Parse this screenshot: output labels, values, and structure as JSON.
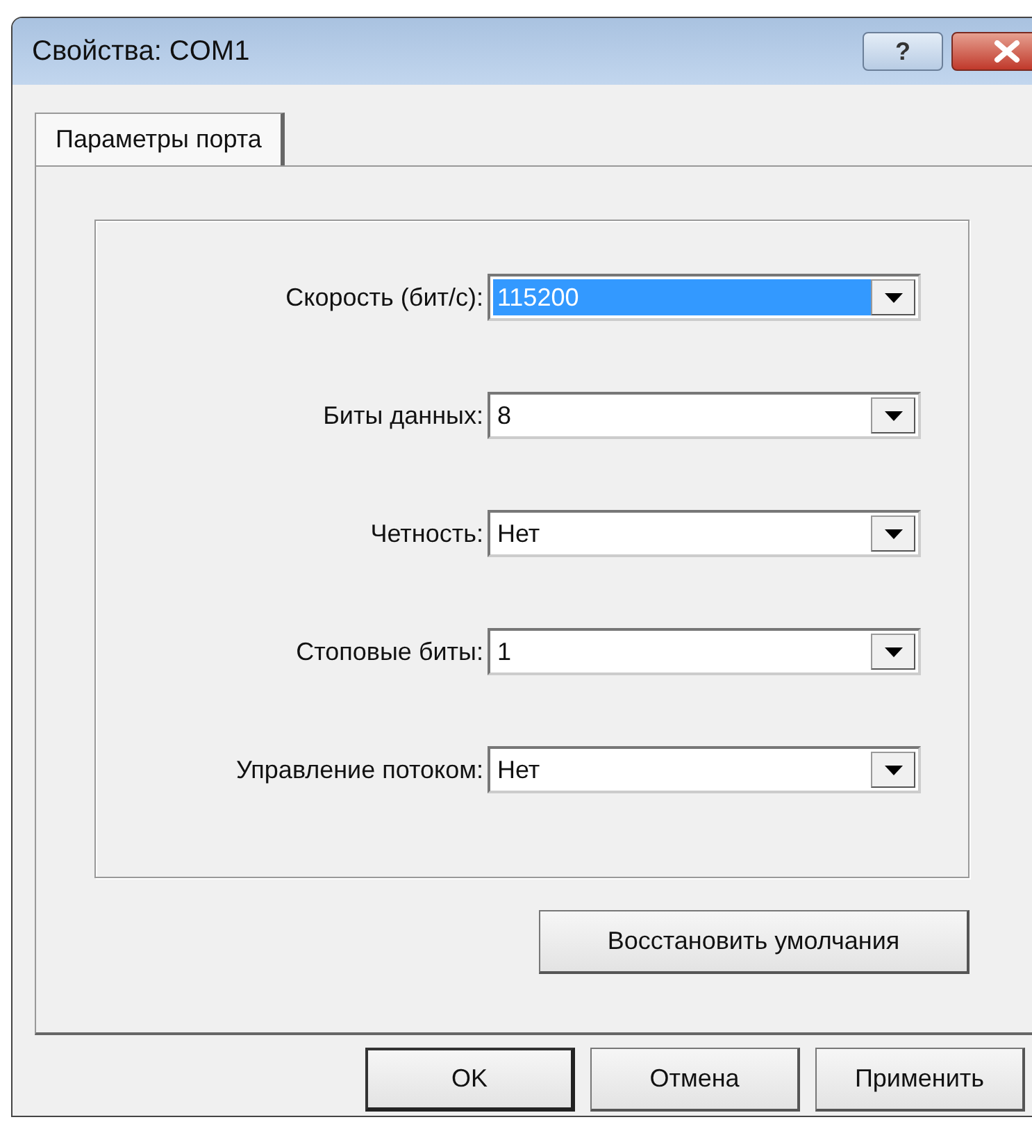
{
  "window": {
    "title": "Свойства: COM1",
    "help_button": "?"
  },
  "tabs": [
    {
      "label": "Параметры порта",
      "selected": true
    }
  ],
  "settings": [
    {
      "label": "Скорость (бит/с):",
      "value": "115200",
      "focused": true
    },
    {
      "label": "Биты данных:",
      "value": "8",
      "focused": false
    },
    {
      "label": "Четность:",
      "value": "Нет",
      "focused": false
    },
    {
      "label": "Стоповые биты:",
      "value": "1",
      "focused": false
    },
    {
      "label": "Управление потоком:",
      "value": "Нет",
      "focused": false
    }
  ],
  "restore_button": "Восстановить умолчания",
  "buttons": [
    {
      "label": "OK",
      "default": true
    },
    {
      "label": "Отмена",
      "default": false
    },
    {
      "label": "Применить",
      "default": false
    }
  ]
}
